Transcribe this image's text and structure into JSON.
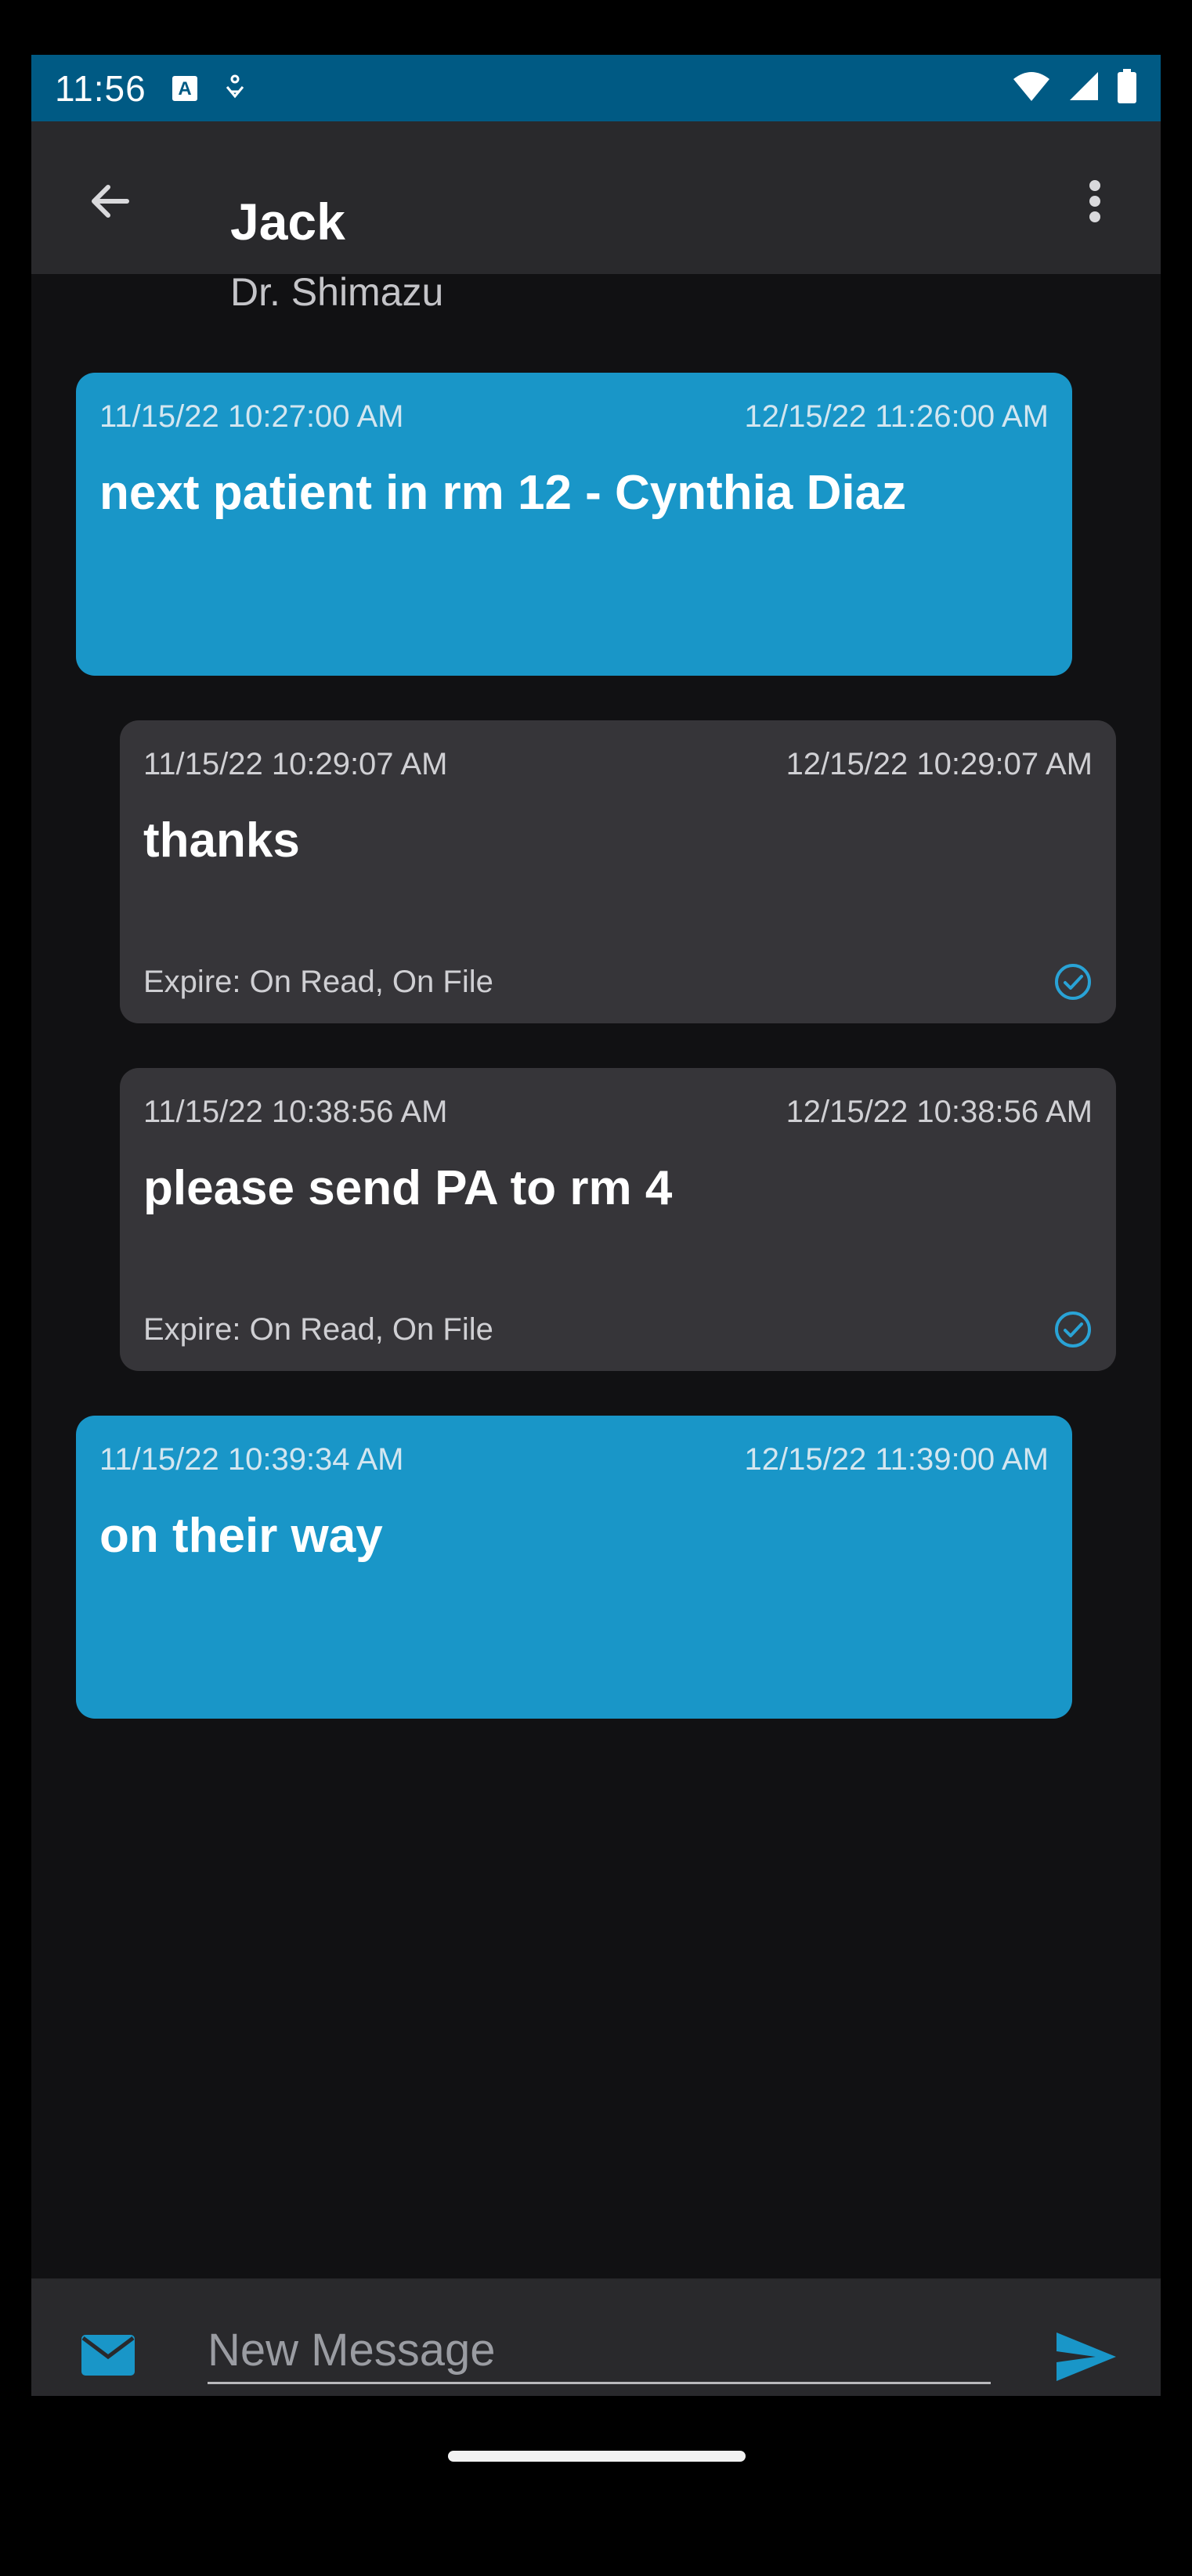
{
  "status_bar": {
    "time": "11:56",
    "icons": [
      "a-notification-icon",
      "accessibility-icon",
      "wifi-icon",
      "signal-icon",
      "battery-icon"
    ]
  },
  "app_bar": {
    "contact_name": "Jack",
    "contact_subtitle": "Dr. Shimazu",
    "icons": [
      "back-arrow-icon",
      "more-vert-icon"
    ]
  },
  "messages": [
    {
      "direction": "sent",
      "sent_time": "11/15/22 10:27:00 AM",
      "expire_time": "12/15/22 11:26:00 AM",
      "text": "next patient in rm 12 - Cynthia Diaz"
    },
    {
      "direction": "received",
      "sent_time": "11/15/22 10:29:07 AM",
      "expire_time": "12/15/22 10:29:07 AM",
      "text": "thanks",
      "expire_rule": "Expire: On Read, On File",
      "read": true
    },
    {
      "direction": "received",
      "sent_time": "11/15/22 10:38:56 AM",
      "expire_time": "12/15/22 10:38:56 AM",
      "text": "please send PA to rm 4",
      "expire_rule": "Expire: On Read, On File",
      "read": true
    },
    {
      "direction": "sent",
      "sent_time": "11/15/22 10:39:34 AM",
      "expire_time": "12/15/22 11:39:00 AM",
      "text": "on their way"
    }
  ],
  "composer": {
    "placeholder": "New Message",
    "icons": [
      "mail-icon",
      "send-icon"
    ]
  },
  "colors": {
    "status_bar": "#005a84",
    "app_bar": "#29292c",
    "background": "#111113",
    "sent_bubble": "#1996c8",
    "received_bubble": "#363539",
    "accent": "#29a3d6"
  }
}
